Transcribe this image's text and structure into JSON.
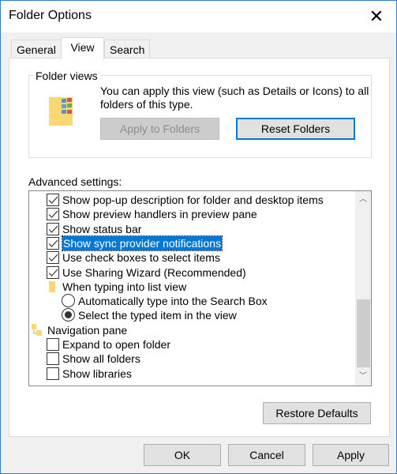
{
  "window": {
    "title": "Folder Options",
    "close_icon": "close-icon"
  },
  "tabs": [
    {
      "label": "General"
    },
    {
      "label": "View",
      "active": true
    },
    {
      "label": "Search"
    }
  ],
  "folder_views": {
    "label": "Folder views",
    "description": "You can apply this view (such as Details or Icons) to all folders of this type.",
    "apply_label": "Apply to Folders",
    "reset_label": "Reset Folders"
  },
  "advanced": {
    "label": "Advanced settings:",
    "items": [
      {
        "type": "checkbox",
        "label": "Show pop-up description for folder and desktop items",
        "checked": true
      },
      {
        "type": "checkbox",
        "label": "Show preview handlers in preview pane",
        "checked": true
      },
      {
        "type": "checkbox",
        "label": "Show status bar",
        "checked": true
      },
      {
        "type": "checkbox",
        "label": "Show sync provider notifications",
        "checked": true,
        "selected": true
      },
      {
        "type": "checkbox",
        "label": "Use check boxes to select items",
        "checked": true
      },
      {
        "type": "checkbox",
        "label": "Use Sharing Wizard (Recommended)",
        "checked": true
      },
      {
        "type": "folder",
        "label": "When typing into list view"
      },
      {
        "type": "radio",
        "label": "Automatically type into the Search Box",
        "checked": false
      },
      {
        "type": "radio",
        "label": "Select the typed item in the view",
        "checked": true
      },
      {
        "type": "group",
        "label": "Navigation pane"
      },
      {
        "type": "checkbox",
        "label": "Expand to open folder",
        "checked": false
      },
      {
        "type": "checkbox",
        "label": "Show all folders",
        "checked": false
      },
      {
        "type": "checkbox",
        "label": "Show libraries",
        "checked": false
      }
    ]
  },
  "restore_label": "Restore Defaults",
  "footer": {
    "ok": "OK",
    "cancel": "Cancel",
    "apply": "Apply"
  },
  "colors": {
    "accent": "#0078d7",
    "folder": "#f8d775"
  }
}
